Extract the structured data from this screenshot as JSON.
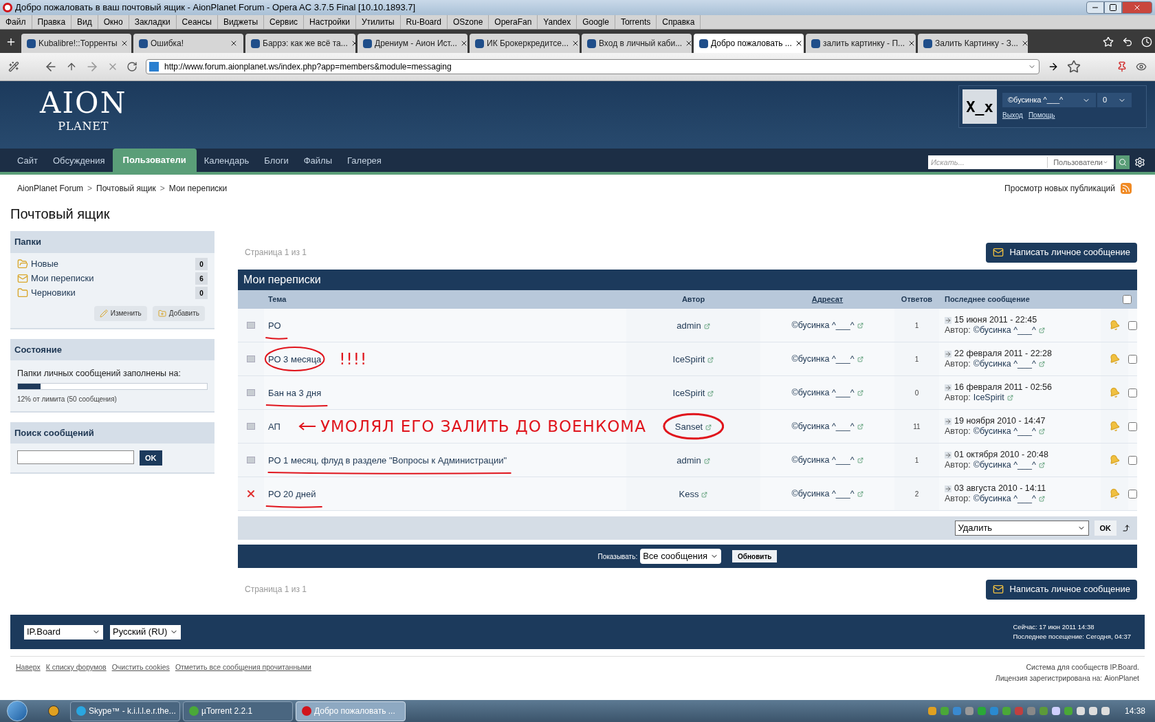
{
  "browser": {
    "title": "Добро пожаловать в ваш почтовый ящик - AionPlanet Forum - Opera AC 3.7.5 Final [10.10.1893.7]",
    "menu": [
      "Файл",
      "Правка",
      "Вид",
      "Окно",
      "Закладки",
      "Сеансы",
      "Виджеты",
      "Сервис",
      "Настройки",
      "Утилиты",
      "Ru-Board",
      "OSzone",
      "OperaFan",
      "Yandex",
      "Google",
      "Torrents",
      "Справка"
    ],
    "tabs": [
      {
        "label": "Kubalibre!::Торренты",
        "selected": false
      },
      {
        "label": "Ошибка!",
        "selected": false
      },
      {
        "label": "Баррэ: как же всё та...",
        "selected": false
      },
      {
        "label": "Дрениум - Аион Ист...",
        "selected": false
      },
      {
        "label": "ИК Брокеркредитсе...",
        "selected": false
      },
      {
        "label": "Вход в личный каби...",
        "selected": false
      },
      {
        "label": "Добро пожаловать ...",
        "selected": true
      },
      {
        "label": "залить картинку - П...",
        "selected": false
      },
      {
        "label": "Залить Картинку - З...",
        "selected": false
      }
    ],
    "url": "http://www.forum.aionplanet.ws/index.php?app=members&module=messaging"
  },
  "header": {
    "logo_top": "AION",
    "logo_bottom": "PLANET",
    "avatar_text": "X_x",
    "username": "©бусинка ^___^",
    "count": "0",
    "links": [
      "Выход",
      "Помощь"
    ]
  },
  "nav": {
    "items": [
      {
        "label": "Сайт",
        "selected": false
      },
      {
        "label": "Обсуждения",
        "selected": false
      },
      {
        "label": "Пользователи",
        "selected": true
      },
      {
        "label": "Календарь",
        "selected": false
      },
      {
        "label": "Блоги",
        "selected": false
      },
      {
        "label": "Файлы",
        "selected": false
      },
      {
        "label": "Галерея",
        "selected": false
      }
    ],
    "search_placeholder": "Искать...",
    "search_scope": "Пользователи"
  },
  "breadcrumb": [
    {
      "label": "AionPlanet Forum"
    },
    {
      "separator": ">",
      "label": "Почтовый ящик"
    },
    {
      "separator": ">",
      "label": "Мои переписки"
    }
  ],
  "new_posts_link": "Просмотр новых публикаций",
  "page_title": "Почтовый ящик",
  "sidebar": {
    "folders_title": "Папки",
    "folders": [
      {
        "kind": "new",
        "label": "Новые",
        "count": "0"
      },
      {
        "kind": "conversations",
        "label": "Мои переписки",
        "count": "6"
      },
      {
        "kind": "drafts",
        "label": "Черновики",
        "count": "0"
      }
    ],
    "folder_buttons": [
      {
        "kind": "edit",
        "label": "Изменить"
      },
      {
        "kind": "add",
        "label": "Добавить"
      }
    ],
    "status_title": "Состояние",
    "status_text": "Папки личных сообщений заполнены на:",
    "level": 0.12,
    "status_note": "12% от лимита (50 сообщения)",
    "search_title": "Поиск сообщений",
    "search_button": "OK"
  },
  "pagination_top": "Страница 1 из 1",
  "compose_button": "Написать личное сообщение",
  "table": {
    "title": "Мои переписки",
    "columns": [
      {
        "label": "Тема",
        "link": false
      },
      {
        "label": "Автор",
        "link": false
      },
      {
        "label": "Адресат",
        "link": true
      },
      {
        "label": "Ответов",
        "link": false
      },
      {
        "label": "Последнее сообщение",
        "link": false
      }
    ],
    "select_all_checked": false,
    "rows": [
      {
        "deleted": false,
        "topic": "РО",
        "topic_underlined": true,
        "topic_circled": false,
        "author": "admin",
        "author_circled": false,
        "recipient": "©бусинка ^___^",
        "replies": "1",
        "last_date": "15 июня 2011 - 22:45",
        "last_by_label": "Автор:",
        "last_by": "©бусинка ^___^",
        "checked": false
      },
      {
        "deleted": false,
        "topic": "РО 3 месяца",
        "topic_underlined": false,
        "topic_circled": true,
        "note": "!!!!",
        "note_arrow": false,
        "author": "IceSpirit",
        "author_circled": false,
        "recipient": "©бусинка ^___^",
        "replies": "1",
        "last_date": "22 февраля 2011 - 22:28",
        "last_by_label": "Автор:",
        "last_by": "©бусинка ^___^",
        "checked": false
      },
      {
        "deleted": false,
        "topic": "Бан на 3 дня",
        "topic_underlined": true,
        "topic_circled": false,
        "author": "IceSpirit",
        "author_circled": false,
        "recipient": "©бусинка ^___^",
        "replies": "0",
        "last_date": "16 февраля 2011 - 02:56",
        "last_by_label": "Автор:",
        "last_by": "IceSpirit",
        "checked": false
      },
      {
        "deleted": false,
        "topic": "АП",
        "topic_underlined": false,
        "topic_circled": false,
        "note": "УМОЛЯЛ ЕГО ЗАЛИТЬ ДО ВОЕНКОМА",
        "note_arrow": true,
        "author": "Sanset",
        "author_circled": true,
        "recipient": "©бусинка ^___^",
        "replies": "11",
        "last_date": "19 ноября 2010 - 14:47",
        "last_by_label": "Автор:",
        "last_by": "©бусинка ^___^",
        "checked": false
      },
      {
        "deleted": false,
        "topic": "РО 1 месяц, флуд в разделе \"Вопросы к Администрации\"",
        "topic_underlined": true,
        "topic_circled": false,
        "author": "admin",
        "author_circled": false,
        "recipient": "©бусинка ^___^",
        "replies": "1",
        "last_date": "01 октября 2010 - 20:48",
        "last_by_label": "Автор:",
        "last_by": "©бусинка ^___^",
        "checked": false
      },
      {
        "deleted": true,
        "topic": "РО 20 дней",
        "topic_underlined": true,
        "topic_circled": false,
        "author": "Kess",
        "author_circled": false,
        "recipient": "©бусинка ^___^",
        "replies": "2",
        "last_date": "03 августа 2010 - 14:11",
        "last_by_label": "Автор:",
        "last_by": "©бусинка ^___^",
        "checked": false
      }
    ],
    "action_select": "Удалить",
    "action_button": "OK",
    "show_label": "Показывать:",
    "show_select": "Все сообщения",
    "refresh_button": "Обновить"
  },
  "pagination_bottom": "Страница 1 из 1",
  "compose_button_bottom": "Написать личное сообщение",
  "footer": {
    "skin": "IP.Board",
    "language": "Русский (RU)",
    "now": "Сейчас: 17 июн 2011 14:38",
    "last_visit": "Последнее посещение: Сегодня, 04:37",
    "links": [
      "Наверх",
      "К списку форумов",
      "Очистить cookies",
      "Отметить все сообщения прочитанными"
    ],
    "credit": "Система для сообществ IP.Board.",
    "license": "Лицензия зарегистрирована на: AionPlanet"
  },
  "taskbar": {
    "items": [
      {
        "kind": "skype",
        "label": "Skype™ - k.i.l.l.e.r.the...",
        "selected": false
      },
      {
        "kind": "torrent",
        "label": "µTorrent 2.2.1",
        "selected": false
      },
      {
        "kind": "opera",
        "label": "Добро пожаловать ...",
        "selected": true
      }
    ],
    "clock": "14:38"
  }
}
